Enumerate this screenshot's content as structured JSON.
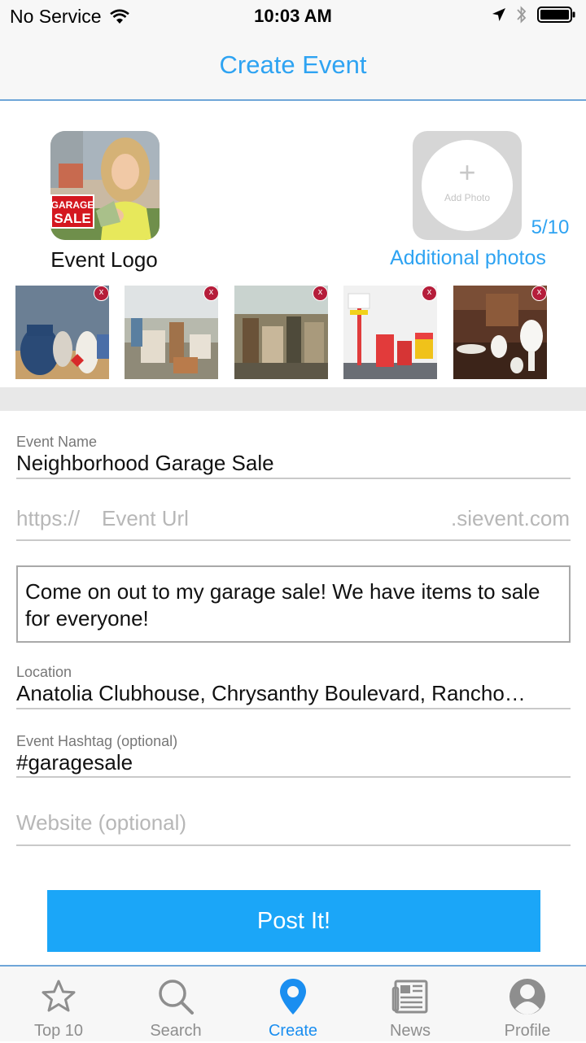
{
  "status_bar": {
    "carrier": "No Service",
    "time": "10:03 AM"
  },
  "nav": {
    "title": "Create Event"
  },
  "logo": {
    "label": "Event Logo",
    "sign_line1": "GARAGE",
    "sign_line2": "SALE"
  },
  "additional": {
    "add_photo_plus": "+",
    "add_photo_text": "Add Photo",
    "count": "5/10",
    "label": "Additional photos"
  },
  "thumbnails": {
    "remove_label": "x"
  },
  "form": {
    "event_name_label": "Event Name",
    "event_name_value": "Neighborhood Garage Sale",
    "url_prefix": "https://",
    "url_placeholder": "Event Url",
    "url_suffix": ".sievent.com",
    "description": "Come on out to my garage sale! We have items to sale for everyone!",
    "location_label": "Location",
    "location_value": "Anatolia Clubhouse, Chrysanthy Boulevard, Rancho…",
    "hashtag_label": "Event Hashtag (optional)",
    "hashtag_value": "#garagesale",
    "website_placeholder": "Website (optional)"
  },
  "post_button": "Post It!",
  "tabs": [
    {
      "label": "Top 10",
      "icon": "star-icon"
    },
    {
      "label": "Search",
      "icon": "search-icon"
    },
    {
      "label": "Create",
      "icon": "location-pin-icon"
    },
    {
      "label": "News",
      "icon": "newspaper-icon"
    },
    {
      "label": "Profile",
      "icon": "profile-icon"
    }
  ],
  "colors": {
    "accent": "#2ea3f2",
    "button": "#1ba6f8",
    "remove_badge": "#b51d3a"
  }
}
